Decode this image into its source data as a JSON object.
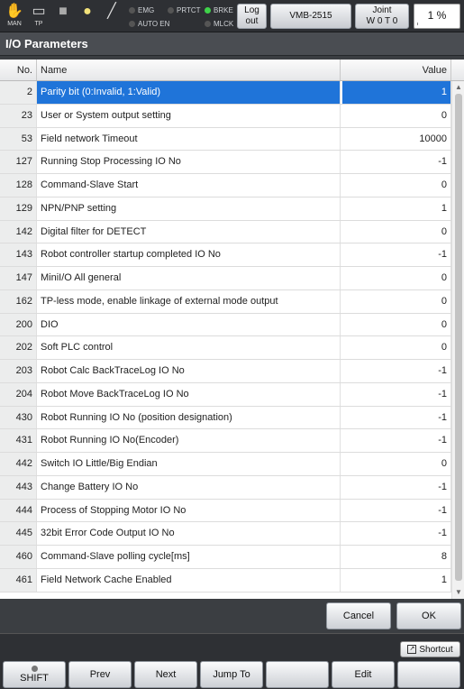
{
  "topbar": {
    "mode_icons": [
      {
        "icon": "hand-icon",
        "label": "MAN"
      },
      {
        "icon": "teach-pendant-icon",
        "label": "TP"
      },
      {
        "icon": "stop-square-icon",
        "label": ""
      },
      {
        "icon": "lightbulb-icon",
        "label": ""
      },
      {
        "icon": "wrench-icon",
        "label": ""
      }
    ],
    "indicators": {
      "emg": "EMG",
      "auto_en": "AUTO EN",
      "prtct": "PRTCT",
      "brke": "BRKE",
      "mlck": "MLCK"
    },
    "logout_line1": "Log",
    "logout_line2": "out",
    "robot_model": "VMB-2515",
    "joint_line1": "Joint",
    "joint_line2": "W 0 T 0",
    "speed_percent": "1 %",
    "speed_value": 1
  },
  "title": "I/O Parameters",
  "table": {
    "headers": {
      "no": "No.",
      "name": "Name",
      "value": "Value"
    },
    "selected_index": 0,
    "rows": [
      {
        "no": "2",
        "name": "Parity bit (0:Invalid, 1:Valid)",
        "value": "1"
      },
      {
        "no": "23",
        "name": "User or System output setting",
        "value": "0"
      },
      {
        "no": "53",
        "name": "Field network Timeout",
        "value": "10000"
      },
      {
        "no": "127",
        "name": "Running Stop Processing IO No",
        "value": "-1"
      },
      {
        "no": "128",
        "name": "Command-Slave Start",
        "value": "0"
      },
      {
        "no": "129",
        "name": "NPN/PNP setting",
        "value": "1"
      },
      {
        "no": "142",
        "name": "Digital filter for DETECT",
        "value": "0"
      },
      {
        "no": "143",
        "name": "Robot controller startup completed IO No",
        "value": "-1"
      },
      {
        "no": "147",
        "name": "MiniI/O All general",
        "value": "0"
      },
      {
        "no": "162",
        "name": "TP-less mode, enable linkage of external mode output",
        "value": "0"
      },
      {
        "no": "200",
        "name": "DIO",
        "value": "0"
      },
      {
        "no": "202",
        "name": "Soft PLC control",
        "value": "0"
      },
      {
        "no": "203",
        "name": "Robot Calc BackTraceLog IO No",
        "value": "-1"
      },
      {
        "no": "204",
        "name": "Robot Move BackTraceLog IO No",
        "value": "-1"
      },
      {
        "no": "430",
        "name": "Robot Running IO No (position designation)",
        "value": "-1"
      },
      {
        "no": "431",
        "name": "Robot Running IO No(Encoder)",
        "value": "-1"
      },
      {
        "no": "442",
        "name": "Switch IO Little/Big Endian",
        "value": "0"
      },
      {
        "no": "443",
        "name": "Change Battery IO No",
        "value": "-1"
      },
      {
        "no": "444",
        "name": "Process of Stopping Motor IO No",
        "value": "-1"
      },
      {
        "no": "445",
        "name": "32bit Error Code Output IO No",
        "value": "-1"
      },
      {
        "no": "460",
        "name": "Command-Slave polling cycle[ms]",
        "value": "8"
      },
      {
        "no": "461",
        "name": "Field Network Cache Enabled",
        "value": "1"
      }
    ]
  },
  "dialog": {
    "cancel": "Cancel",
    "ok": "OK"
  },
  "fnbar": {
    "shortcut": "Shortcut",
    "keys": [
      "SHIFT",
      "Prev",
      "Next",
      "Jump To",
      "",
      "Edit",
      ""
    ]
  },
  "colors": {
    "selection": "#1f74d9",
    "indicator_on": "#3fd34a"
  }
}
